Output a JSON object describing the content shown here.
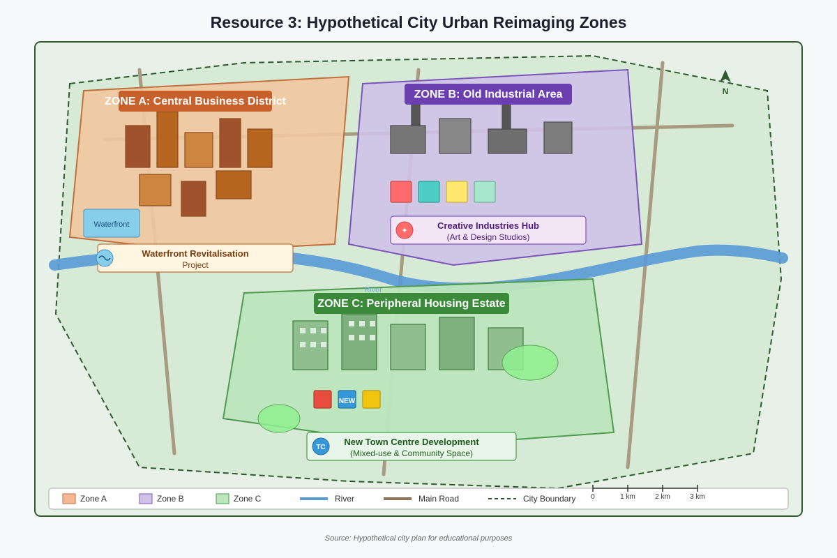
{
  "title": "Resource 3: Hypothetical City Urban Reimaging Zones",
  "colors": {
    "zone_a_fill": "#f0c8a0",
    "zone_a_stroke": "#c0703f",
    "zone_a_label": "#c8602c",
    "zone_b_fill": "#cfc2e6",
    "zone_b_stroke": "#7a55b8",
    "zone_b_label": "#6b3fb0",
    "zone_c_fill": "#bde6bd",
    "zone_c_stroke": "#4e9a4e",
    "zone_c_label": "#3a8a3a",
    "river": "#5b9bd5",
    "road": "#a0906e",
    "boundary": "#2e5a2e",
    "map_bg": "#e6f0e6"
  },
  "zones": {
    "a": {
      "label": "ZONE A: Central Business District"
    },
    "b": {
      "label": "ZONE B: Old Industrial Area"
    },
    "c": {
      "label": "ZONE C: Peripheral Housing Estate"
    }
  },
  "features": {
    "waterfront_box": "Waterfront",
    "river_label": "River"
  },
  "callouts": {
    "waterfront": {
      "icon": "wave-icon",
      "title": "Waterfront Revitalisation",
      "subtitle": "Project"
    },
    "creative": {
      "icon": "star-icon",
      "icon_text": "✦",
      "title": "Creative Industries Hub",
      "subtitle": "(Art & Design Studios)"
    },
    "towncentre": {
      "icon": "tc-badge-icon",
      "icon_text": "TC",
      "title": "New Town Centre Development",
      "subtitle": "(Mixed-use & Community Space)"
    }
  },
  "badges": {
    "new": "NEW"
  },
  "compass": {
    "label": "N",
    "icon": "north-arrow-icon"
  },
  "legend": [
    {
      "label": "Zone A",
      "swatch": "zone_a"
    },
    {
      "label": "Zone B",
      "swatch": "zone_b"
    },
    {
      "label": "Zone C",
      "swatch": "zone_c"
    },
    {
      "label": "River",
      "swatch": "river"
    },
    {
      "label": "Main Road",
      "swatch": "road"
    },
    {
      "label": "City Boundary",
      "swatch": "boundary"
    }
  ],
  "scale": [
    "0",
    "1 km",
    "2 km",
    "3 km"
  ],
  "source": "Source: Hypothetical city plan for educational purposes"
}
